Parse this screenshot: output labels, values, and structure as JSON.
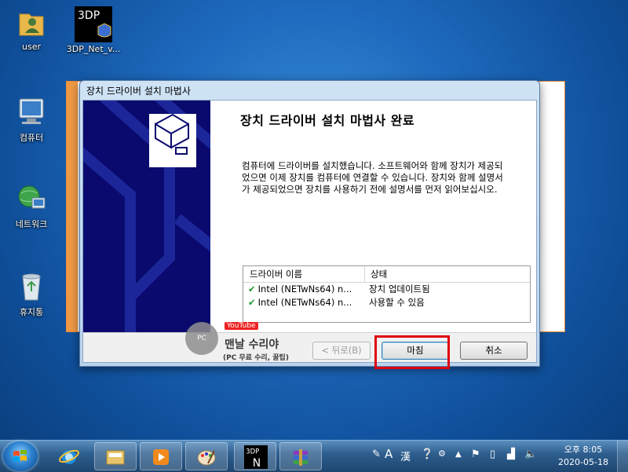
{
  "desktop": {
    "icons": [
      {
        "label": "user"
      },
      {
        "label": "3DP_Net_v..."
      },
      {
        "label": "컴퓨터"
      },
      {
        "label": "네트워크"
      },
      {
        "label": "휴지통"
      }
    ]
  },
  "dialog": {
    "window_title": "장치 드라이버 설치 마법사",
    "heading": "장치 드라이버 설치 마법사 완료",
    "description": "컴퓨터에 드라이버를 설치했습니다. 소프트웨어와 함께 장치가 제공되었으면 이제 장치를 컴퓨터에 연결할 수 있습니다. 장치와 함께 설명서가 제공되었으면 장치를 사용하기 전에 설명서를 먼저 읽어보십시오.",
    "table": {
      "columns": [
        "드라이버 이름",
        "상태"
      ],
      "rows": [
        {
          "name": "Intel (NETwNs64) n...",
          "status": "장치 업데이트됨"
        },
        {
          "name": "Intel (NETwNs64) n...",
          "status": "사용할 수 있음"
        }
      ]
    },
    "buttons": {
      "back": "< 뒤로(B)",
      "finish": "마침",
      "cancel": "취소"
    }
  },
  "watermark": {
    "badge": "PC",
    "youtube": "YouTube",
    "name": "맨날 수리야",
    "sub": "(PC 무료 수리, 꿀팁)"
  },
  "taskbar": {
    "pinned": [
      "internet-explorer",
      "file-explorer",
      "media-player",
      "paint",
      "3dp-net",
      "winrar"
    ],
    "tray": {
      "ime_a": "A",
      "ime_han": "漢",
      "time": "오후 8:05",
      "date": "2020-05-18"
    }
  },
  "colors": {
    "highlight": "#e00010",
    "side_panel": "#0a0a6e"
  }
}
